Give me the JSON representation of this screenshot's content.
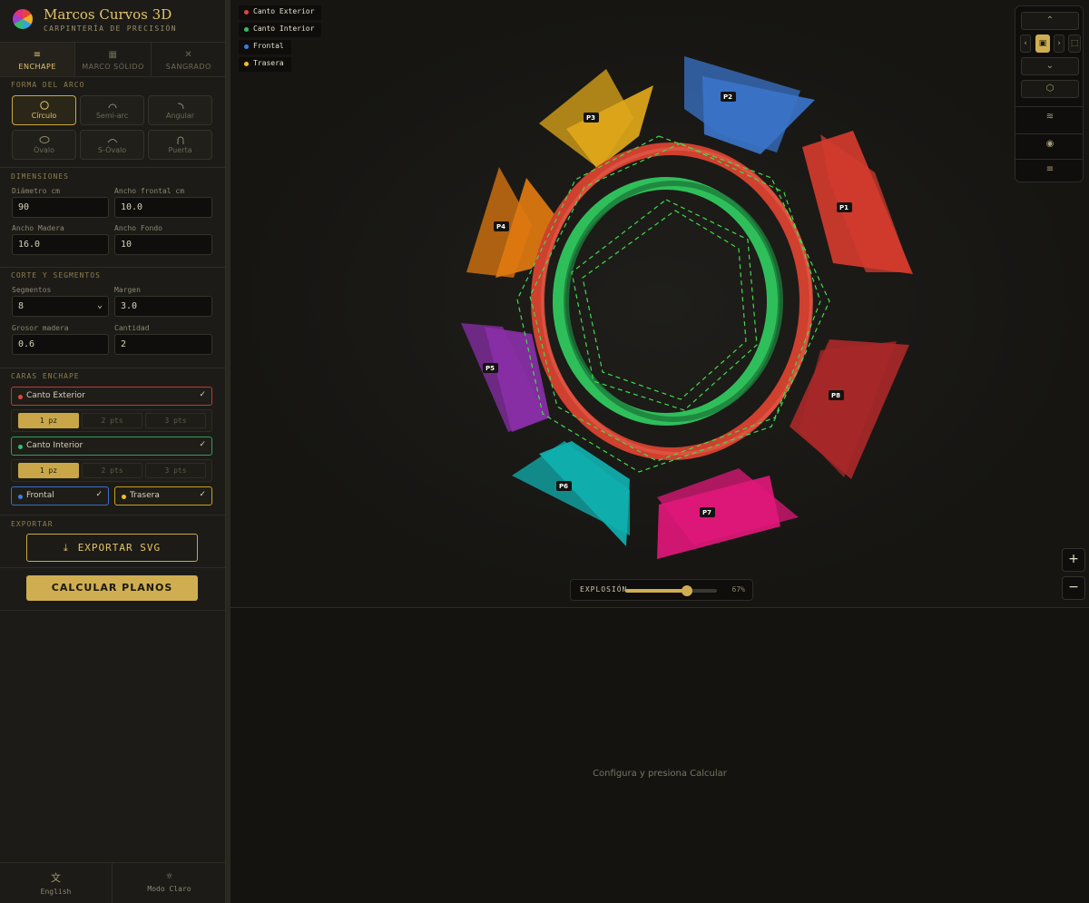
{
  "app": {
    "title": "Marcos Curvos 3D",
    "subtitle": "CARPINTERÍA DE PRECISIÓN"
  },
  "tabs": [
    {
      "label": "ENCHAPE",
      "icon": "layers-icon"
    },
    {
      "label": "MARCO SÓLIDO",
      "icon": "grid-icon"
    },
    {
      "label": "SANGRADO",
      "icon": "cross-icon"
    }
  ],
  "shape": {
    "section": "FORMA DEL ARCO",
    "options": [
      "Círculo",
      "Semi-arc",
      "Angular",
      "Óvalo",
      "S-Óvalo",
      "Puerta"
    ],
    "selected": "Círculo"
  },
  "dimensions": {
    "section": "DIMENSIONES",
    "diameter": {
      "label": "Diámetro cm",
      "value": "90"
    },
    "front_width": {
      "label": "Ancho frontal cm",
      "value": "10.0"
    },
    "wood_width": {
      "label": "Ancho Madera",
      "value": "16.0"
    },
    "back_width": {
      "label": "Ancho Fondo",
      "value": "10"
    }
  },
  "cut": {
    "section": "CORTE Y SEGMENTOS",
    "segments": {
      "label": "Segmentos",
      "value": "8"
    },
    "margin": {
      "label": "Margen",
      "value": "3.0"
    },
    "thickness": {
      "label": "Grosor madera",
      "value": "0.6"
    },
    "quantity": {
      "label": "Cantidad",
      "value": "2"
    }
  },
  "faces": {
    "section": "CARAS ENCHAPE",
    "exterior": {
      "label": "Canto Exterior",
      "color": "#e0473a",
      "check": "✓"
    },
    "interior": {
      "label": "Canto Interior",
      "color": "#2fbf6f",
      "check": "✓"
    },
    "frontal": {
      "label": "Frontal",
      "color": "#3a7fe0",
      "check": "✓"
    },
    "back": {
      "label": "Trasera",
      "color": "#f0c020",
      "check": "✓"
    },
    "pieces": [
      "1 pz",
      "2 pts",
      "3 pts"
    ]
  },
  "export": {
    "section": "EXPORTAR",
    "label": "EXPORTAR SVG"
  },
  "calculate": {
    "label": "CALCULAR PLANOS"
  },
  "footer": {
    "language": {
      "label": "English",
      "icon": "translate-icon"
    },
    "theme": {
      "label": "Modo Claro",
      "icon": "sun-icon"
    }
  },
  "legend": [
    {
      "label": "Canto Exterior",
      "color": "#e0473a"
    },
    {
      "label": "Canto Interior",
      "color": "#2fbf6f"
    },
    {
      "label": "Frontal",
      "color": "#3a7fe0"
    },
    {
      "label": "Trasera",
      "color": "#f0c020"
    }
  ],
  "panels": [
    {
      "label": "P1",
      "color": "#d23b2e"
    },
    {
      "label": "P2",
      "color": "#3a74c9"
    },
    {
      "label": "P3",
      "color": "#e0a81a"
    },
    {
      "label": "P4",
      "color": "#e07a10"
    },
    {
      "label": "P5",
      "color": "#8a2fa8"
    },
    {
      "label": "P6",
      "color": "#10b0b0"
    },
    {
      "label": "P7",
      "color": "#e0187a"
    },
    {
      "label": "P8",
      "color": "#a82828"
    }
  ],
  "explosion": {
    "label": "EXPLOSIÓN",
    "value": 67,
    "value_text": "67%"
  },
  "result": {
    "message": "Configura y presiona Calcular"
  }
}
